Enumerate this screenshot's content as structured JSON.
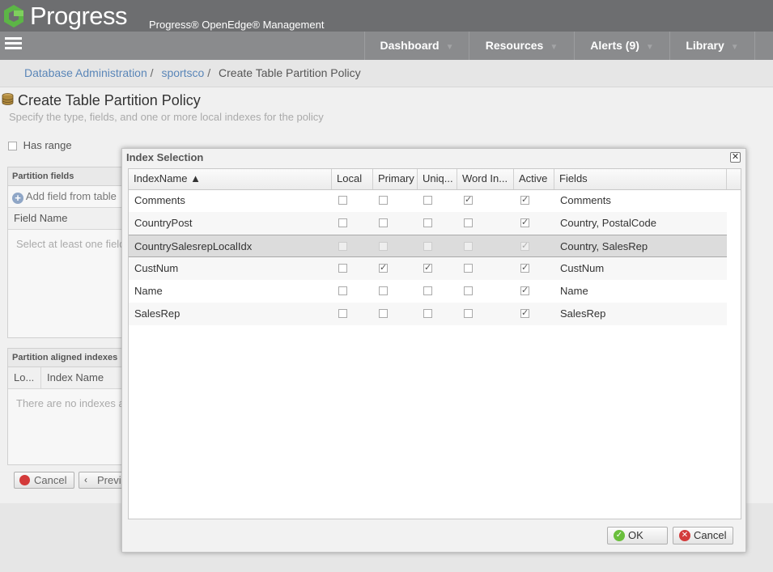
{
  "header": {
    "brand": "Progress",
    "app_title": "Progress® OpenEdge® Management"
  },
  "nav": {
    "items": [
      {
        "label": "Dashboard"
      },
      {
        "label": "Resources"
      },
      {
        "label": "Alerts (9)"
      },
      {
        "label": "Library"
      }
    ],
    "caret": "▼"
  },
  "breadcrumb": {
    "items": [
      "Database Administration",
      "sportsco"
    ],
    "current": "Create Table Partition Policy",
    "separator": "/"
  },
  "page": {
    "title": "Create Table Partition Policy",
    "subtitle": "Specify the type, fields, and one or more local indexes for the policy",
    "has_range_label": "Has range",
    "partition_fields": {
      "header": "Partition fields",
      "add_label": "Add field from table",
      "column": "Field Name",
      "empty": "Select at least one field"
    },
    "aligned_indexes": {
      "header": "Partition aligned indexes",
      "col_local": "Lo...",
      "col_name": "Index Name",
      "empty": "There are no indexes a"
    },
    "cancel_label": "Cancel",
    "previous_label": "Previ"
  },
  "dialog": {
    "title": "Index Selection",
    "close_glyph": "✕",
    "columns": [
      "IndexName ▲",
      "Local",
      "Primary",
      "Uniq...",
      "Word In...",
      "Active",
      "Fields"
    ],
    "rows": [
      {
        "name": "Comments",
        "local": false,
        "primary": false,
        "unique": false,
        "word": true,
        "active": true,
        "fields": "Comments",
        "selected": false
      },
      {
        "name": "CountryPost",
        "local": false,
        "primary": false,
        "unique": false,
        "word": false,
        "active": true,
        "fields": "Country, PostalCode",
        "selected": false
      },
      {
        "name": "CountrySalesrepLocalIdx",
        "local": false,
        "primary": false,
        "unique": false,
        "word": false,
        "active": true,
        "fields": "Country, SalesRep",
        "selected": true
      },
      {
        "name": "CustNum",
        "local": false,
        "primary": true,
        "unique": true,
        "word": false,
        "active": true,
        "fields": "CustNum",
        "selected": false
      },
      {
        "name": "Name",
        "local": false,
        "primary": false,
        "unique": false,
        "word": false,
        "active": true,
        "fields": "Name",
        "selected": false
      },
      {
        "name": "SalesRep",
        "local": false,
        "primary": false,
        "unique": false,
        "word": false,
        "active": true,
        "fields": "SalesRep",
        "selected": false
      }
    ],
    "ok_label": "OK",
    "cancel_label": "Cancel"
  },
  "colors": {
    "header_bg": "#6d6e70",
    "nav_bg": "#8a8b8d",
    "brand_green": "#5cb646",
    "link": "#5a86b8",
    "ok_green": "#6abf3c",
    "cancel_red": "#d33a3a"
  }
}
